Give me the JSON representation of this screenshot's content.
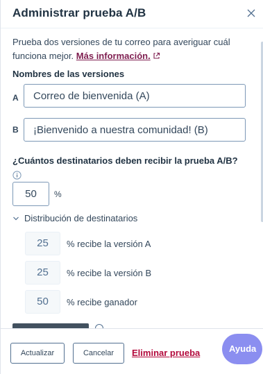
{
  "header": {
    "title": "Administrar prueba A/B"
  },
  "description": {
    "text": "Prueba dos versiones de tu correo para averiguar cuál funciona mejor.",
    "link": "Más información."
  },
  "versions": {
    "label": "Nombres de las versiones",
    "a_letter": "A",
    "a_value": "Correo de bienvenida (A)",
    "b_letter": "B",
    "b_value": "¡Bienvenido a nuestra comunidad! (B)"
  },
  "recipients": {
    "label": "¿Cuántos destinatarios deben recibir la prueba A/B?",
    "percent_value": "50",
    "percent_sign": "%"
  },
  "distribution": {
    "label": "Distribución de destinatarios",
    "rows": [
      {
        "value": "25",
        "text": "% recibe la versión A"
      },
      {
        "value": "25",
        "text": "% recibe la versión B"
      },
      {
        "value": "50",
        "text": "% recibe ganador"
      }
    ]
  },
  "footer": {
    "update_label": "Actualizar",
    "cancel_label": "Cancelar",
    "delete_label": "Eliminar prueba",
    "help_label": "Ayuda"
  },
  "colors": {
    "text": "#33475b",
    "heading": "#213343",
    "link": "#7e1d4f",
    "danger": "#b3093c",
    "help_bubble": "#8b8ef0",
    "input_border": "#7c98b6"
  },
  "icons": {
    "close": "close-icon",
    "external_link": "external-link-icon",
    "info": "info-icon",
    "chevron": "chevron-down-icon"
  }
}
